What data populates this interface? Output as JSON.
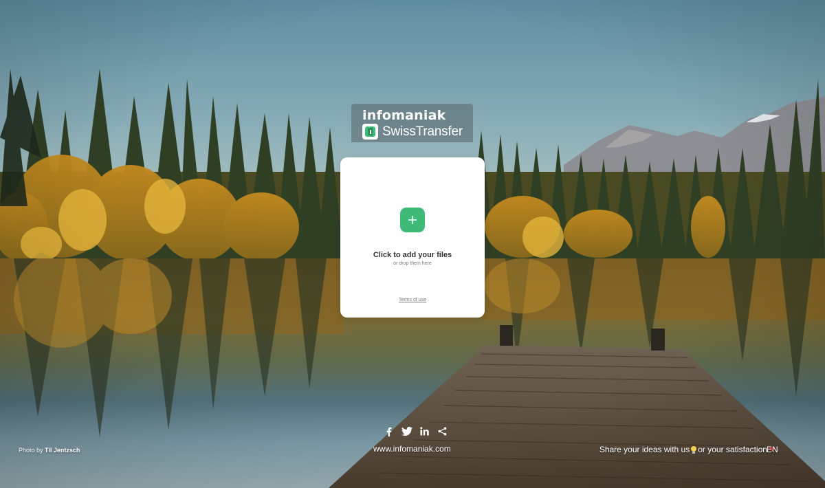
{
  "brand": {
    "company": "infomaniak",
    "product": "SwissTransfer",
    "icon": "swisstransfer-logo-icon"
  },
  "upload": {
    "icon": "plus-icon",
    "button_color": "#3ebb78",
    "title": "Click to add your files",
    "subtitle": "or drop them here",
    "terms_label": "Terms of use"
  },
  "footer": {
    "social": [
      {
        "name": "facebook-icon"
      },
      {
        "name": "twitter-icon"
      },
      {
        "name": "linkedin-icon"
      },
      {
        "name": "share-icon"
      }
    ],
    "website": "www.infomaniak.com",
    "credit_prefix": "Photo by",
    "credit_author": "Til Jentzsch",
    "feedback_ideas": "Share your ideas with us",
    "feedback_or": " or your satisfaction",
    "language": "EN"
  }
}
